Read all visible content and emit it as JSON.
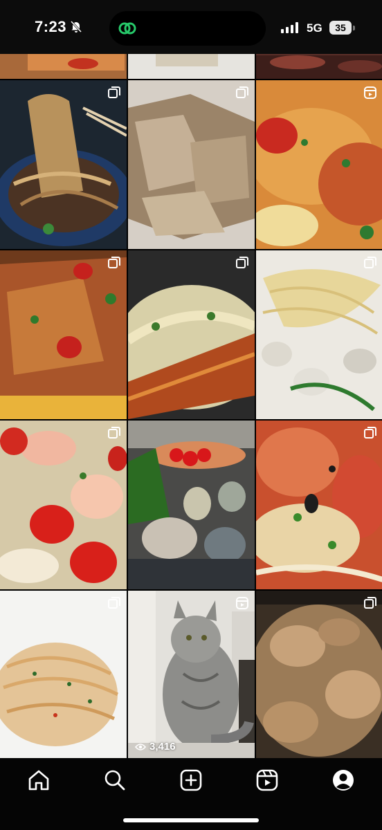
{
  "status_bar": {
    "time": "7:23",
    "network": "5G",
    "battery": "35"
  },
  "grid": {
    "tiles": [
      {
        "row": "partial",
        "subject": "pizza-slice",
        "badge": "none"
      },
      {
        "row": "partial",
        "subject": "pasta-bowl-edge",
        "badge": "none"
      },
      {
        "row": "partial",
        "subject": "steak-slices",
        "badge": "none"
      },
      {
        "row": 1,
        "subject": "noodles-chopsticks",
        "badge": "carousel-icon"
      },
      {
        "row": 1,
        "subject": "pappardelle-truffle",
        "badge": "carousel-icon"
      },
      {
        "row": 1,
        "subject": "ravioli-tomato",
        "badge": "reel-icon"
      },
      {
        "row": 2,
        "subject": "lasagna-tomato",
        "badge": "carousel-icon"
      },
      {
        "row": 2,
        "subject": "lobster-pasta",
        "badge": "carousel-icon"
      },
      {
        "row": 2,
        "subject": "linguine-clams",
        "badge": "carousel-icon"
      },
      {
        "row": 3,
        "subject": "shrimp-tomato",
        "badge": "carousel-icon"
      },
      {
        "row": 3,
        "subject": "seafood-platter",
        "badge": "none"
      },
      {
        "row": 3,
        "subject": "pasta-parmesan",
        "badge": "carousel-icon"
      },
      {
        "row": 4,
        "subject": "linguine-crab",
        "badge": "carousel-icon"
      },
      {
        "row": 4,
        "subject": "gray-tabby-cat",
        "badge": "reel-icon",
        "views": "3,416"
      },
      {
        "row": 4,
        "subject": "frying-oil",
        "badge": "carousel-icon"
      }
    ]
  },
  "nav": {
    "items": [
      "home-icon",
      "search-icon",
      "create-icon",
      "reels-icon",
      "profile-icon"
    ]
  },
  "colors": {
    "background": "#000000",
    "icon": "#ffffff"
  }
}
